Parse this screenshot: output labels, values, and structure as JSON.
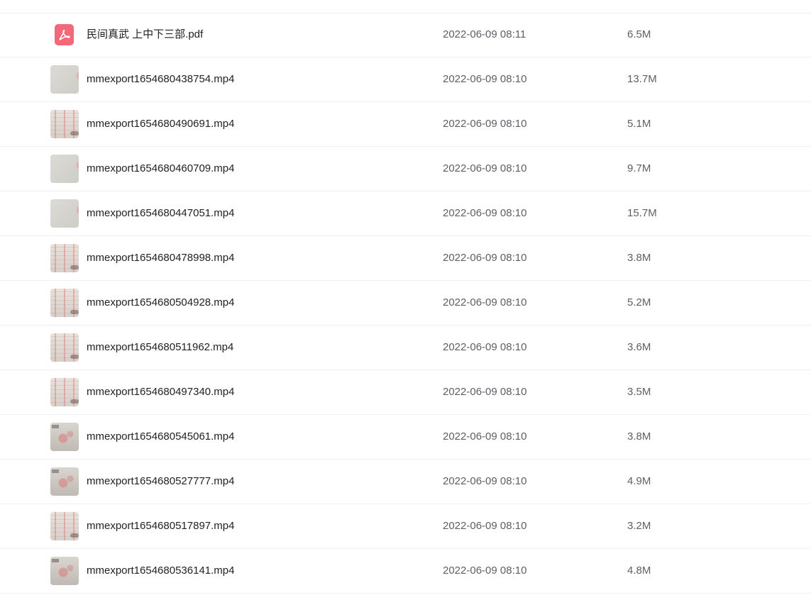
{
  "files": [
    {
      "name": "民间真武 上中下三部.pdf",
      "date": "2022-06-09 08:11",
      "size": "6.5M",
      "icon": "pdf-icon"
    },
    {
      "name": "mmexport1654680438754.mp4",
      "date": "2022-06-09 08:10",
      "size": "13.7M",
      "icon": "video-thumbnail"
    },
    {
      "name": "mmexport1654680490691.mp4",
      "date": "2022-06-09 08:10",
      "size": "5.1M",
      "icon": "video-thumbnail"
    },
    {
      "name": "mmexport1654680460709.mp4",
      "date": "2022-06-09 08:10",
      "size": "9.7M",
      "icon": "video-thumbnail"
    },
    {
      "name": "mmexport1654680447051.mp4",
      "date": "2022-06-09 08:10",
      "size": "15.7M",
      "icon": "video-thumbnail"
    },
    {
      "name": "mmexport1654680478998.mp4",
      "date": "2022-06-09 08:10",
      "size": "3.8M",
      "icon": "video-thumbnail"
    },
    {
      "name": "mmexport1654680504928.mp4",
      "date": "2022-06-09 08:10",
      "size": "5.2M",
      "icon": "video-thumbnail"
    },
    {
      "name": "mmexport1654680511962.mp4",
      "date": "2022-06-09 08:10",
      "size": "3.6M",
      "icon": "video-thumbnail"
    },
    {
      "name": "mmexport1654680497340.mp4",
      "date": "2022-06-09 08:10",
      "size": "3.5M",
      "icon": "video-thumbnail"
    },
    {
      "name": "mmexport1654680545061.mp4",
      "date": "2022-06-09 08:10",
      "size": "3.8M",
      "icon": "video-thumbnail"
    },
    {
      "name": "mmexport1654680527777.mp4",
      "date": "2022-06-09 08:10",
      "size": "4.9M",
      "icon": "video-thumbnail"
    },
    {
      "name": "mmexport1654680517897.mp4",
      "date": "2022-06-09 08:10",
      "size": "3.2M",
      "icon": "video-thumbnail"
    },
    {
      "name": "mmexport1654680536141.mp4",
      "date": "2022-06-09 08:10",
      "size": "4.8M",
      "icon": "video-thumbnail"
    }
  ],
  "colors": {
    "pdf_icon": "#f3697a",
    "divider": "#eef0f3",
    "name_text": "#222222",
    "meta_text": "#5c5f66"
  }
}
